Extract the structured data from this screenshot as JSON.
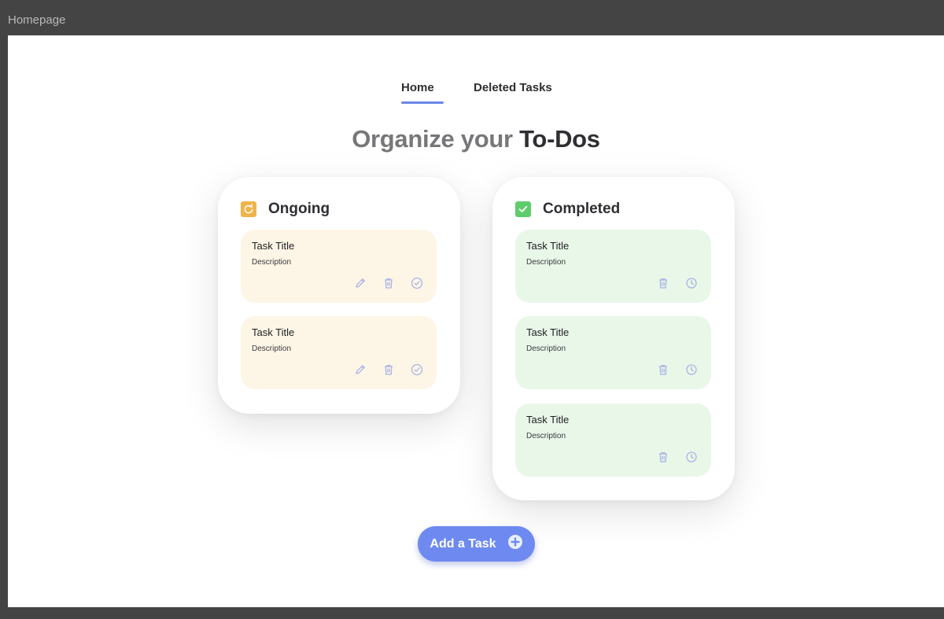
{
  "window": {
    "title": "Homepage"
  },
  "nav": {
    "tabs": [
      {
        "label": "Home",
        "active": true
      },
      {
        "label": "Deleted Tasks",
        "active": false
      }
    ]
  },
  "headline": {
    "part1": "Organize your",
    "part2": "To-Dos"
  },
  "columns": {
    "ongoing": {
      "title": "Ongoing",
      "icon": "refresh-icon",
      "color": "#f0b34a",
      "tasks": [
        {
          "title": "Task Title",
          "description": "Description"
        },
        {
          "title": "Task Title",
          "description": "Description"
        }
      ]
    },
    "completed": {
      "title": "Completed",
      "icon": "check-icon",
      "color": "#5fcc6c",
      "tasks": [
        {
          "title": "Task Title",
          "description": "Description"
        },
        {
          "title": "Task Title",
          "description": "Description"
        },
        {
          "title": "Task Title",
          "description": "Description"
        }
      ]
    }
  },
  "add_button": {
    "label": "Add a Task",
    "icon": "plus-circle-icon"
  },
  "colors": {
    "accent": "#6e8af0",
    "ongoing_card": "#fdf5e6",
    "completed_card": "#e9f7e9",
    "action_icon": "#a9b3e6"
  }
}
